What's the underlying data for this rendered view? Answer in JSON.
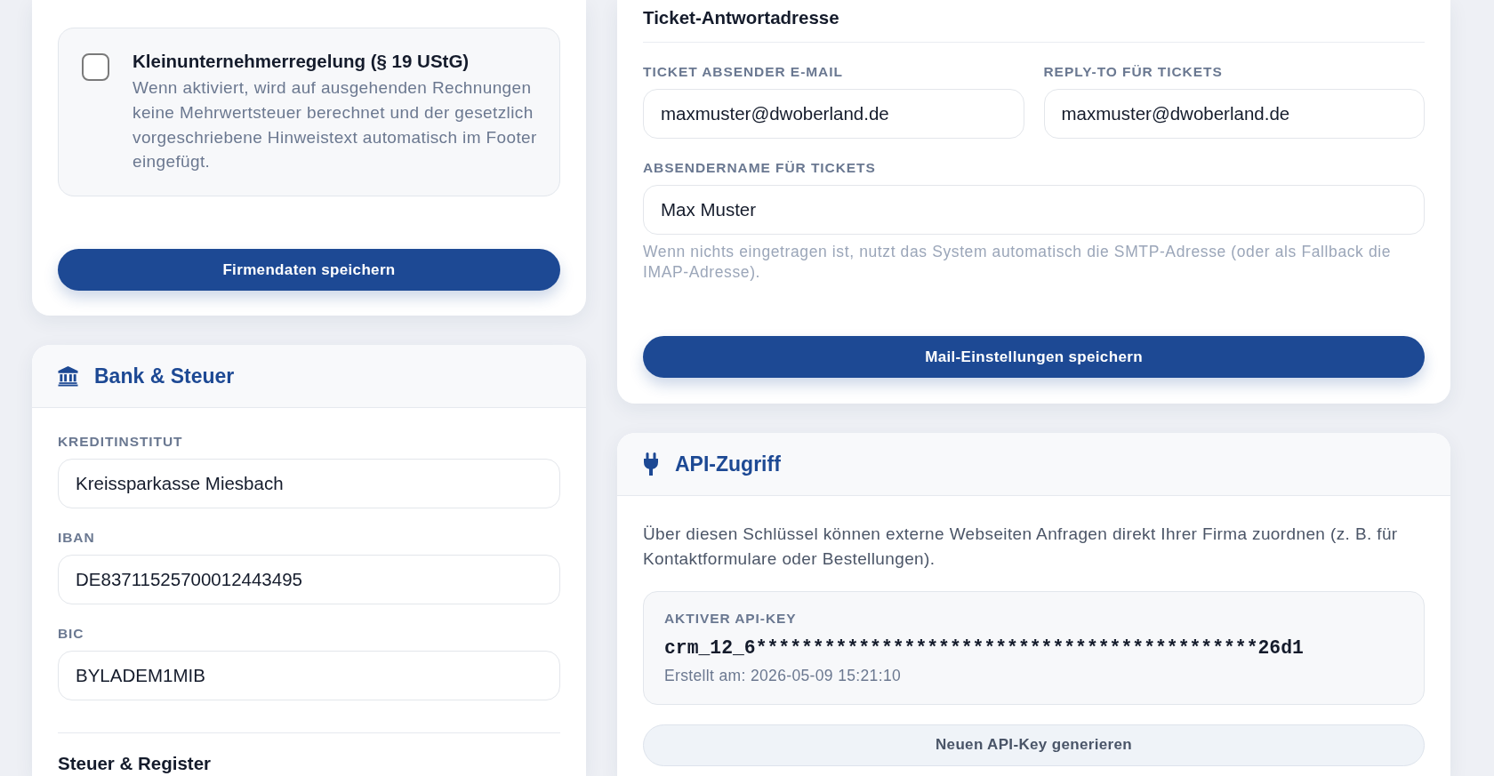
{
  "company_card": {
    "small_business_option": {
      "title": "Kleinunternehmerregelung (§ 19 UStG)",
      "description": "Wenn aktiviert, wird auf ausgehenden Rechnungen keine Mehrwertsteuer berechnet und der gesetzlich vorgeschriebene Hinweistext automatisch im Footer eingefügt.",
      "checked": false
    },
    "save_button": "Firmendaten speichern"
  },
  "bank_tax_card": {
    "title": "Bank & Steuer",
    "fields": [
      {
        "label": "KREDITINSTITUT",
        "value": "Kreissparkasse Miesbach"
      },
      {
        "label": "IBAN",
        "value": "DE83711525700012443495"
      },
      {
        "label": "BIC",
        "value": "BYLADEM1MIB"
      }
    ],
    "next_section_title": "Steuer & Register"
  },
  "mail_card": {
    "section_title": "Ticket-Antwortadresse",
    "field_rows": [
      [
        {
          "label": "TICKET ABSENDER E-MAIL",
          "value": "maxmuster@dwoberland.de"
        },
        {
          "label": "REPLY-TO FÜR TICKETS",
          "value": "maxmuster@dwoberland.de"
        }
      ],
      [
        {
          "label": "ABSENDERNAME FÜR TICKETS",
          "value": "Max Muster"
        }
      ]
    ],
    "hint": "Wenn nichts eingetragen ist, nutzt das System automatisch die SMTP-Adresse (oder als Fallback die IMAP-Adresse).",
    "save_button": "Mail-Einstellungen speichern"
  },
  "api_card": {
    "title": "API-Zugriff",
    "description": "Über diesen Schlüssel können externe Webseiten Anfragen direkt Ihrer Firma zuordnen (z. B. für Kontaktformulare oder Bestellungen).",
    "key_panel": {
      "label": "AKTIVER API-KEY",
      "key": "crm_12_6********************************************26d1",
      "created": "Erstellt am: 2026-05-09 15:21:10"
    },
    "generate_button": "Neuen API-Key generieren"
  }
}
